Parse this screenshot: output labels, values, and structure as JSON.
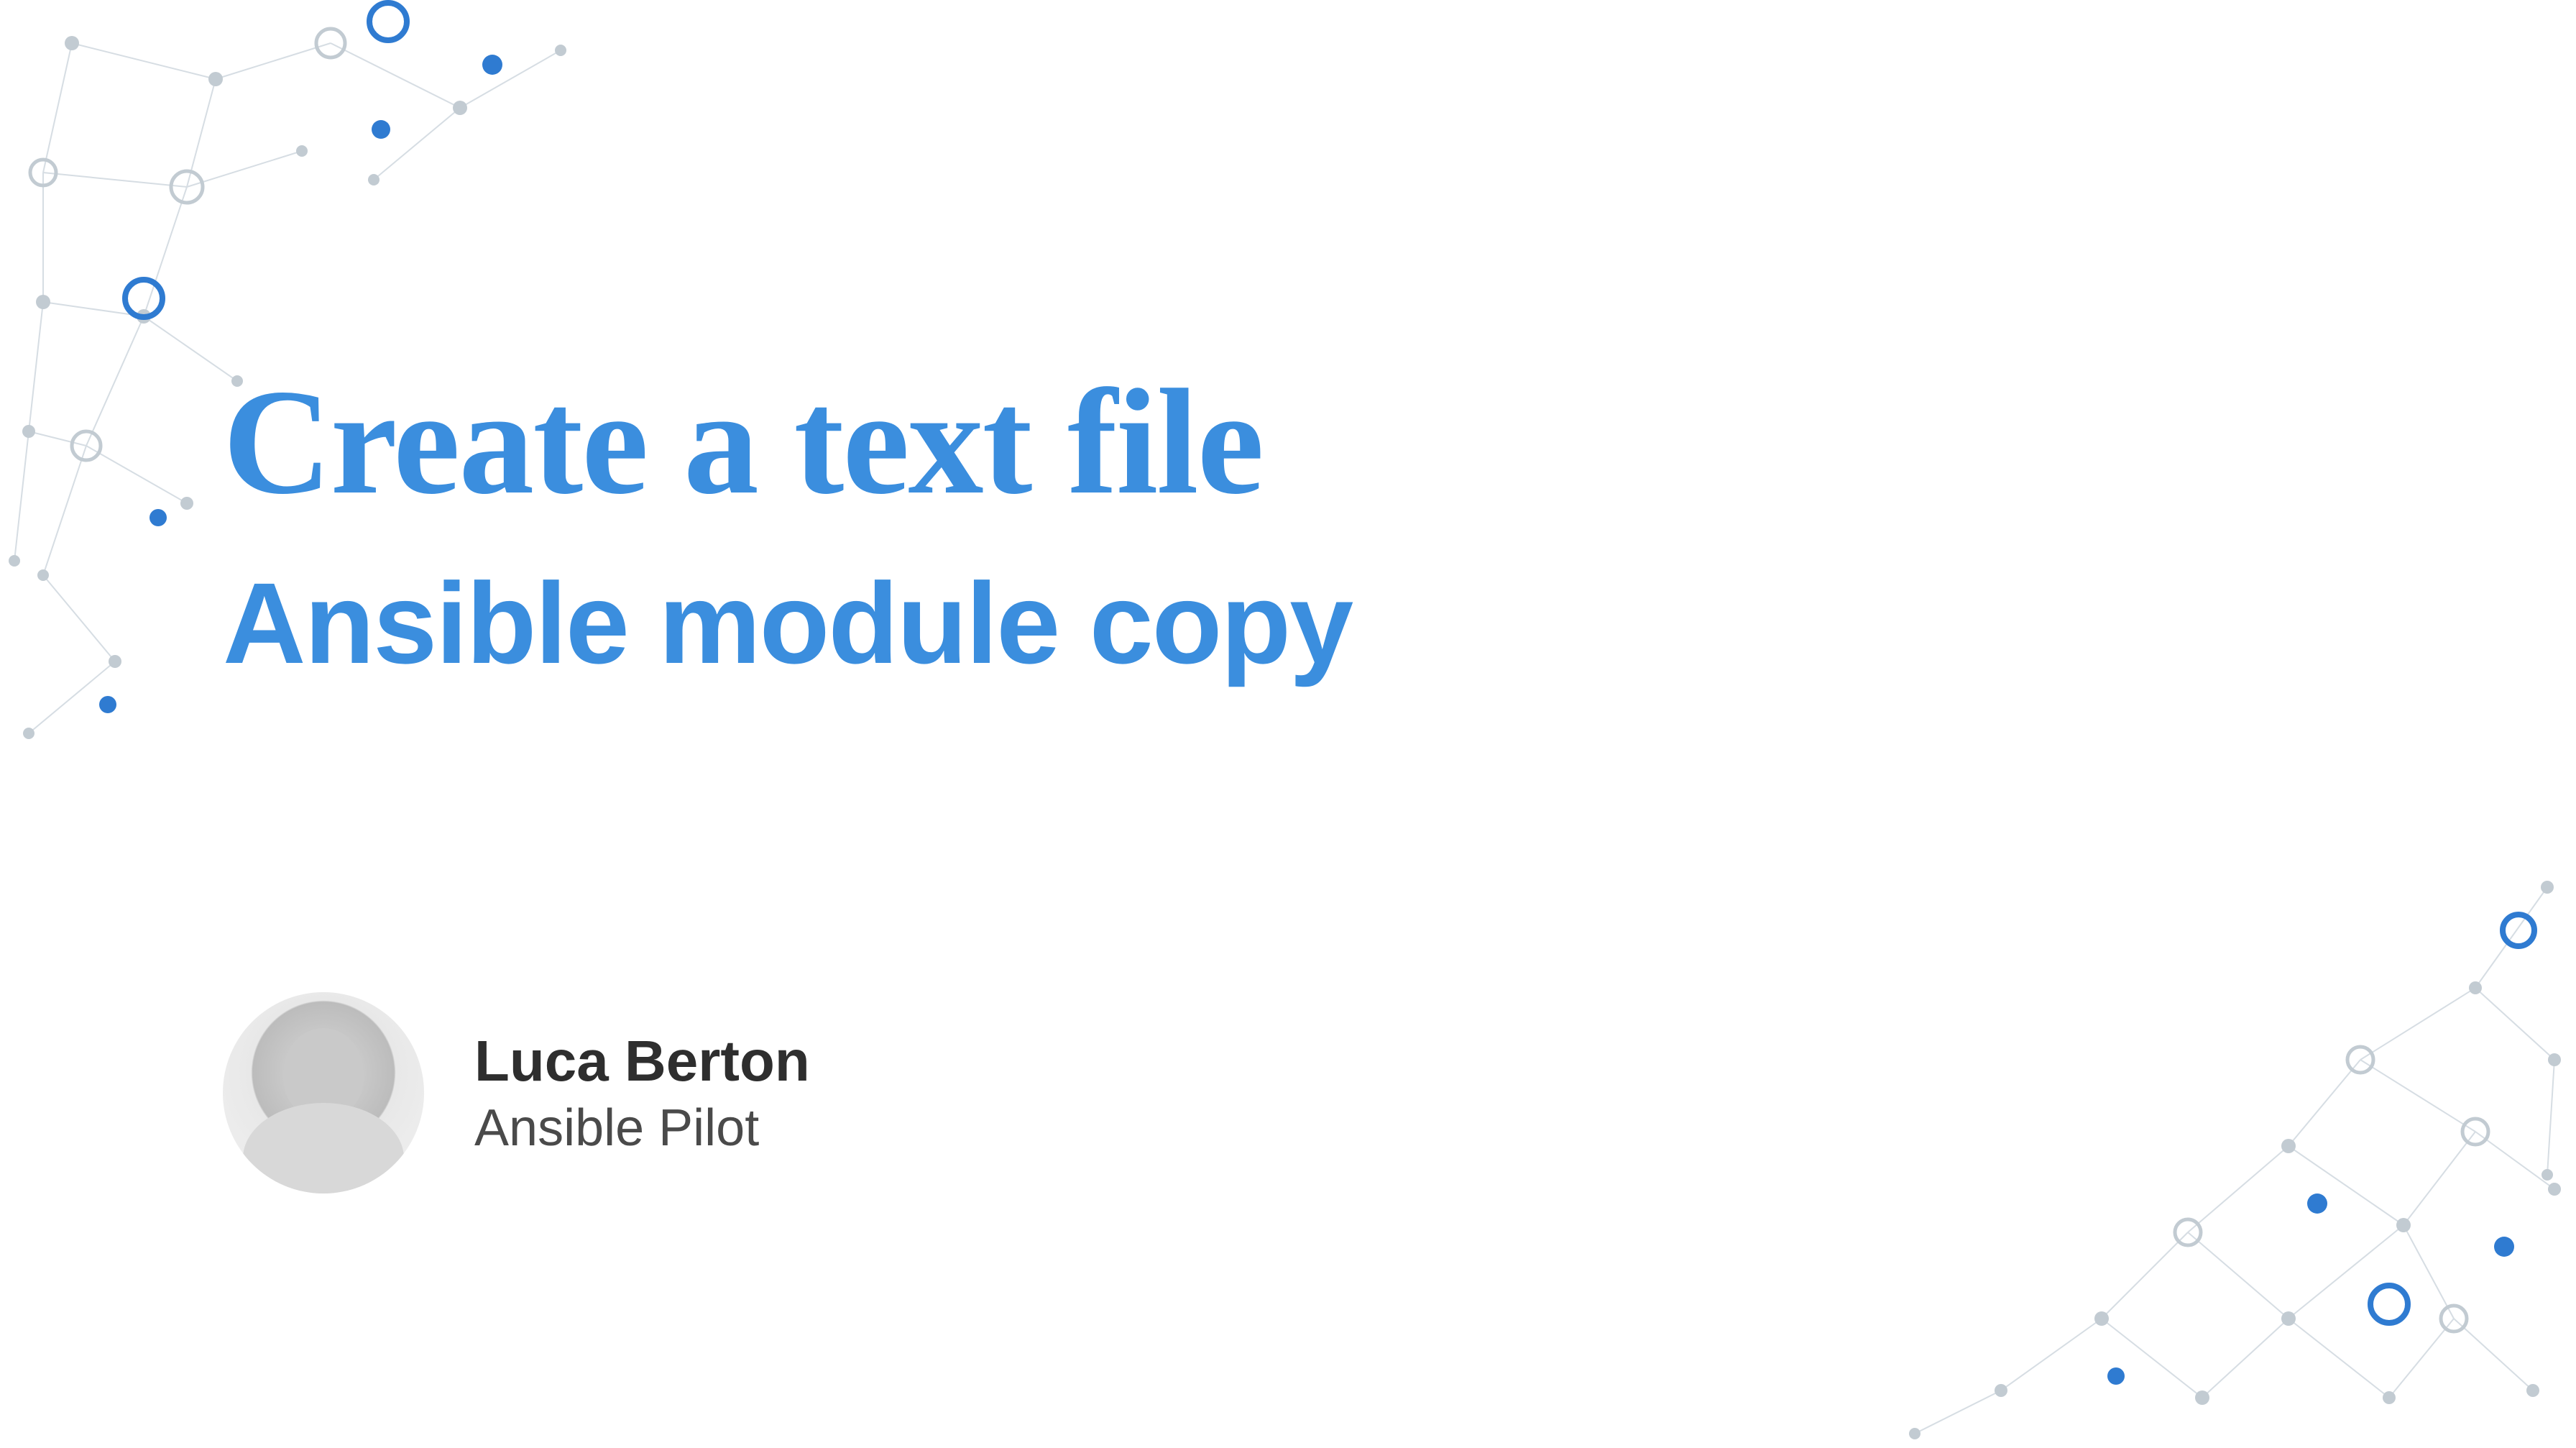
{
  "slide": {
    "title": "Create a text file",
    "subtitle": "Ansible module copy"
  },
  "author": {
    "name": "Luca Berton",
    "role": "Ansible Pilot"
  },
  "colors": {
    "accent": "#3b8ede",
    "text_dark": "#2e2e2e"
  }
}
